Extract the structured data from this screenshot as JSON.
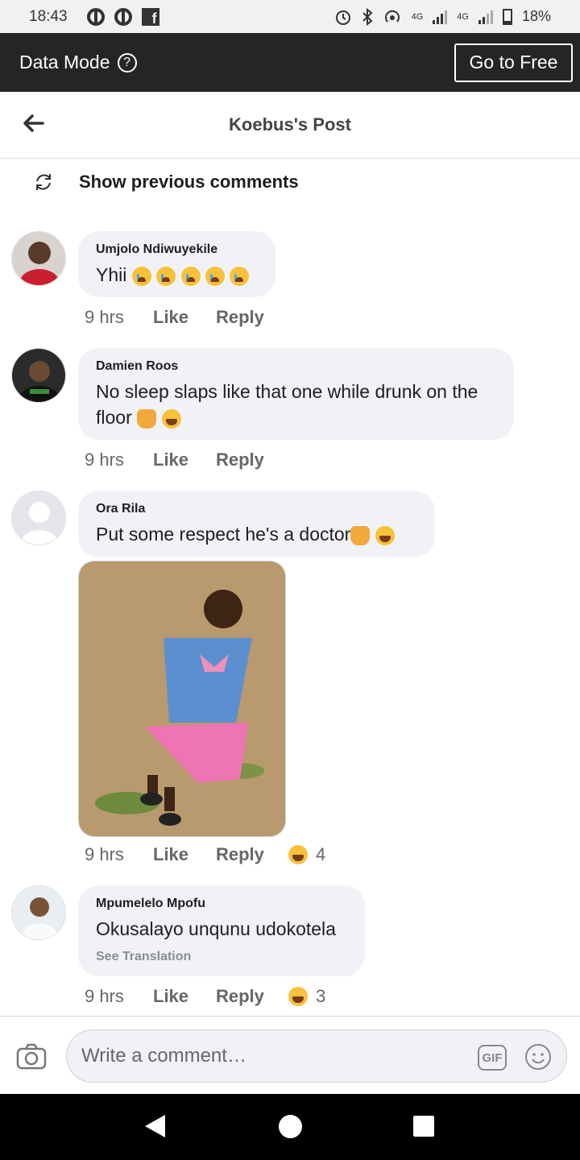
{
  "status_bar": {
    "time": "18:43",
    "network_label": "4G",
    "network_label_2": "4G",
    "battery": "18%"
  },
  "data_mode": {
    "label": "Data Mode",
    "help_glyph": "?",
    "go_free_label": "Go to Free"
  },
  "header": {
    "title": "Koebus's Post"
  },
  "show_previous": "Show previous comments",
  "comments": [
    {
      "author": "Umjolo Ndiwuyekile",
      "text": "Yhii",
      "time": "9 hrs",
      "like": "Like",
      "reply": "Reply"
    },
    {
      "author": "Damien Roos",
      "text": "No sleep slaps like that one while drunk on the floor",
      "time": "9 hrs",
      "like": "Like",
      "reply": "Reply"
    },
    {
      "author": "Ora Rila",
      "text": "Put some respect he's a doctor",
      "time": "9 hrs",
      "like": "Like",
      "reply": "Reply",
      "reaction_count": "4"
    },
    {
      "author": "Mpumelelo Mpofu",
      "text": "Okusalayo unqunu udokotela",
      "see_translation": "See Translation",
      "time": "9 hrs",
      "like": "Like",
      "reply": "Reply",
      "reaction_count": "3"
    }
  ],
  "composer": {
    "placeholder": "Write a comment…",
    "gif_label": "GIF"
  },
  "icons": {
    "back": "arrow-left-icon",
    "refresh": "refresh-icon",
    "camera": "camera-icon",
    "emoji": "smile-icon"
  }
}
